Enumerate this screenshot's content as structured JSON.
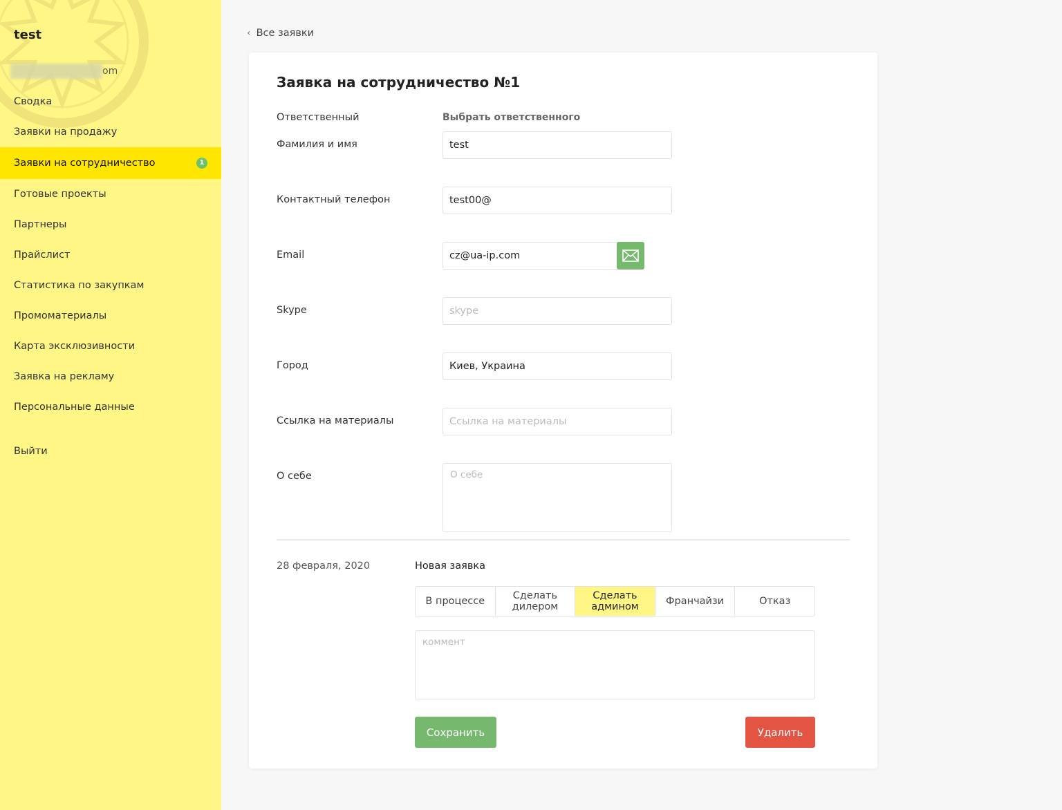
{
  "sidebar": {
    "user_name": "test",
    "user_email_suffix": "om",
    "items": [
      {
        "label": "Сводка"
      },
      {
        "label": "Заявки на продажу"
      },
      {
        "label": "Заявки на сотрудничество",
        "badge": "1",
        "active": true
      },
      {
        "label": "Готовые проекты"
      },
      {
        "label": "Партнеры"
      },
      {
        "label": "Прайслист"
      },
      {
        "label": "Статистика по закупкам"
      },
      {
        "label": "Промоматериалы"
      },
      {
        "label": "Карта эксклюзивности"
      },
      {
        "label": "Заявка на рекламу"
      },
      {
        "label": "Персональные данные"
      }
    ],
    "logout": "Выйти",
    "colors": {
      "background": "#fff685",
      "active": "#ffe600",
      "badge": "#6cc16b"
    }
  },
  "back_link": "Все заявки",
  "card": {
    "title": "Заявка на сотрудничество №1",
    "responsible_label": "Ответственный",
    "responsible_action": "Выбрать ответственного",
    "fields": {
      "name": {
        "label": "Фамилия и имя",
        "value": "test",
        "placeholder": ""
      },
      "phone": {
        "label": "Контактный телефон",
        "value": "test00@",
        "placeholder": ""
      },
      "email": {
        "label": "Email",
        "value": "cz@ua-ip.com",
        "placeholder": ""
      },
      "skype": {
        "label": "Skype",
        "value": "",
        "placeholder": "skype"
      },
      "city": {
        "label": "Город",
        "value": "Киев, Украина",
        "placeholder": ""
      },
      "materials": {
        "label": "Ссылка на материалы",
        "value": "",
        "placeholder": "Ссылка на материалы"
      },
      "about": {
        "label": "О себе",
        "value": "",
        "placeholder": "О себе"
      }
    },
    "date": "28 февраля, 2020",
    "current_status": "Новая заявка",
    "status_options": [
      {
        "label": "В процессе"
      },
      {
        "label": "Сделать дилером"
      },
      {
        "label": "Сделать админом",
        "selected": true
      },
      {
        "label": "Франчайзи"
      },
      {
        "label": "Отказ"
      }
    ],
    "comment_placeholder": "коммент",
    "save_label": "Сохранить",
    "delete_label": "Удалить",
    "colors": {
      "save": "#77b86f",
      "delete": "#e35443",
      "mail": "#77b86f",
      "selected_status": "#fff685"
    }
  }
}
